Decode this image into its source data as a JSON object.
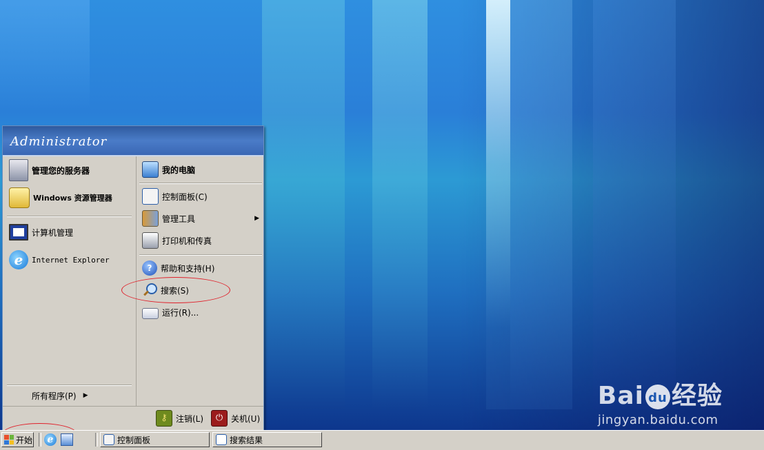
{
  "start_menu": {
    "user": "Administrator",
    "left_items": [
      {
        "label": "管理您的服务器",
        "icon": "server-icon"
      },
      {
        "label": "Windows 资源管理器",
        "icon": "folder-magnifier-icon"
      },
      {
        "label": "计算机管理",
        "icon": "computer-management-icon"
      },
      {
        "label": "Internet Explorer",
        "icon": "internet-explorer-icon"
      }
    ],
    "all_programs": "所有程序(P)",
    "right_items": [
      {
        "label": "我的电脑",
        "icon": "my-computer-icon"
      },
      {
        "label": "控制面板(C)",
        "icon": "control-panel-icon"
      },
      {
        "label": "管理工具",
        "icon": "admin-tools-icon"
      },
      {
        "label": "打印机和传真",
        "icon": "printer-icon"
      },
      {
        "label": "帮助和支持(H)",
        "icon": "help-icon"
      },
      {
        "label": "搜索(S)",
        "icon": "search-icon"
      },
      {
        "label": "运行(R)...",
        "icon": "run-icon"
      }
    ],
    "logoff": "注销(L)",
    "shutdown": "关机(U)"
  },
  "taskbar": {
    "start_label": "开始",
    "tasks": [
      "控制面板",
      "搜索结果"
    ]
  },
  "watermark": {
    "logo_left": "Bai",
    "logo_right": "经验",
    "paw": "du",
    "url": "jingyan.baidu.com"
  },
  "colors": {
    "menu_header": "#3a67b4",
    "menu_body": "#d4d0c8",
    "highlight_ellipse": "#e0202a"
  }
}
